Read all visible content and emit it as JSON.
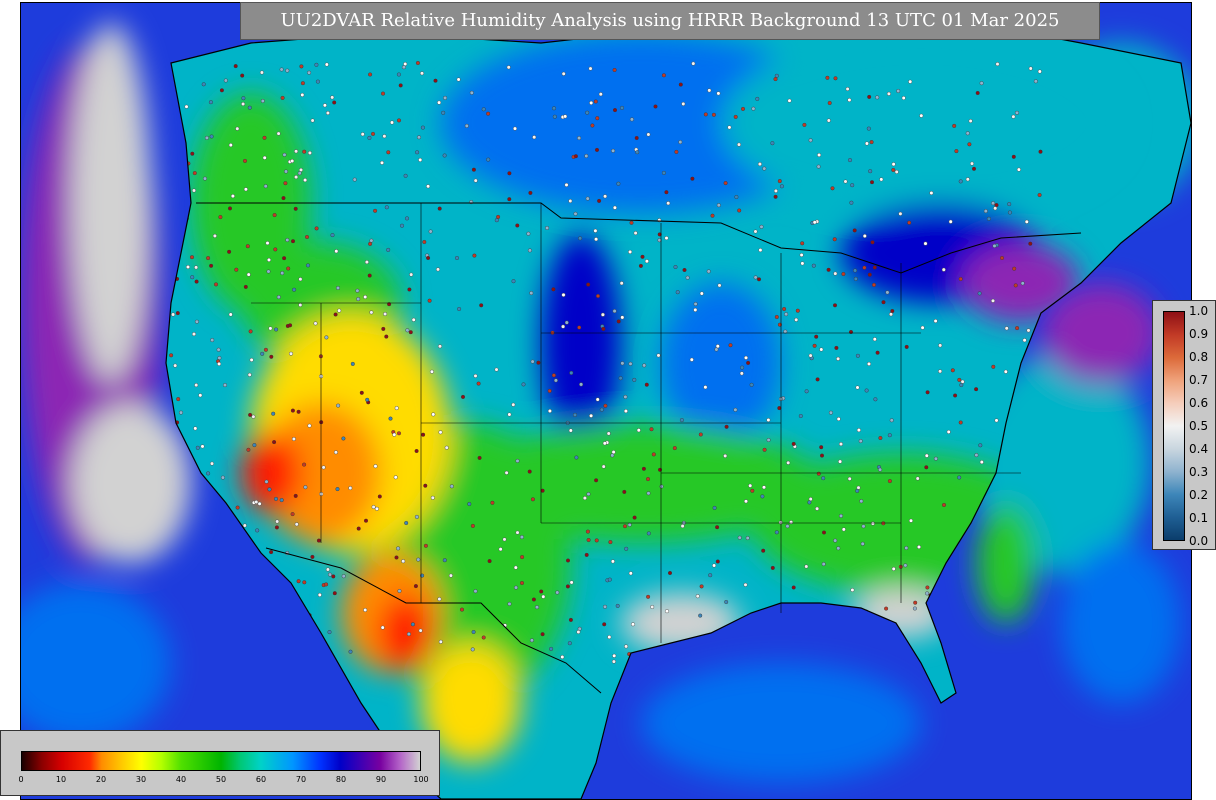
{
  "header": {
    "title": "UU2DVAR Relative Humidity Analysis using HRRR Background 13 UTC 01 Mar 2025"
  },
  "rh_legend": {
    "ticks": [
      "0",
      "10",
      "20",
      "30",
      "40",
      "50",
      "60",
      "70",
      "80",
      "90",
      "100"
    ],
    "stops": [
      {
        "v": 0,
        "c": "#1a0000"
      },
      {
        "v": 5,
        "c": "#8b0000"
      },
      {
        "v": 10,
        "c": "#d60000"
      },
      {
        "v": 17,
        "c": "#ff2a00"
      },
      {
        "v": 20,
        "c": "#ff8c00"
      },
      {
        "v": 25,
        "c": "#ffc800"
      },
      {
        "v": 30,
        "c": "#ffff00"
      },
      {
        "v": 35,
        "c": "#b4ff00"
      },
      {
        "v": 40,
        "c": "#50e000"
      },
      {
        "v": 50,
        "c": "#00b400"
      },
      {
        "v": 55,
        "c": "#00c878"
      },
      {
        "v": 60,
        "c": "#00d2c8"
      },
      {
        "v": 68,
        "c": "#0096ff"
      },
      {
        "v": 75,
        "c": "#0032ff"
      },
      {
        "v": 80,
        "c": "#0000c8"
      },
      {
        "v": 85,
        "c": "#3c00b4"
      },
      {
        "v": 90,
        "c": "#7800a0"
      },
      {
        "v": 95,
        "c": "#b464c8"
      },
      {
        "v": 100,
        "c": "#d2d2d2"
      }
    ]
  },
  "obs_legend": {
    "ticks": [
      "1.0",
      "0.9",
      "0.8",
      "0.7",
      "0.6",
      "0.5",
      "0.4",
      "0.3",
      "0.2",
      "0.1",
      "0.0"
    ],
    "stops": [
      {
        "v": 0.0,
        "c": "#0b3d6b"
      },
      {
        "v": 0.1,
        "c": "#1f5f94"
      },
      {
        "v": 0.2,
        "c": "#3d86b9"
      },
      {
        "v": 0.3,
        "c": "#8fb3cf"
      },
      {
        "v": 0.4,
        "c": "#c9d6df"
      },
      {
        "v": 0.5,
        "c": "#f2f2f2"
      },
      {
        "v": 0.6,
        "c": "#f5cdbb"
      },
      {
        "v": 0.7,
        "c": "#efa27b"
      },
      {
        "v": 0.8,
        "c": "#dc6a3a"
      },
      {
        "v": 0.9,
        "c": "#c23a26"
      },
      {
        "v": 1.0,
        "c": "#8e1016"
      }
    ]
  },
  "map_colors": {
    "ocean_deep": "#1e3cdc",
    "ocean_mid": "#0070f0",
    "land_moist": "#00b4c8",
    "land_green": "#28c828",
    "dry_yellow": "#ffdc00",
    "dry_orange": "#ff8c00",
    "dry_red": "#ff1e00",
    "saturated": "#d2d2d2",
    "purple": "#8c28b4",
    "border": "#000000"
  }
}
